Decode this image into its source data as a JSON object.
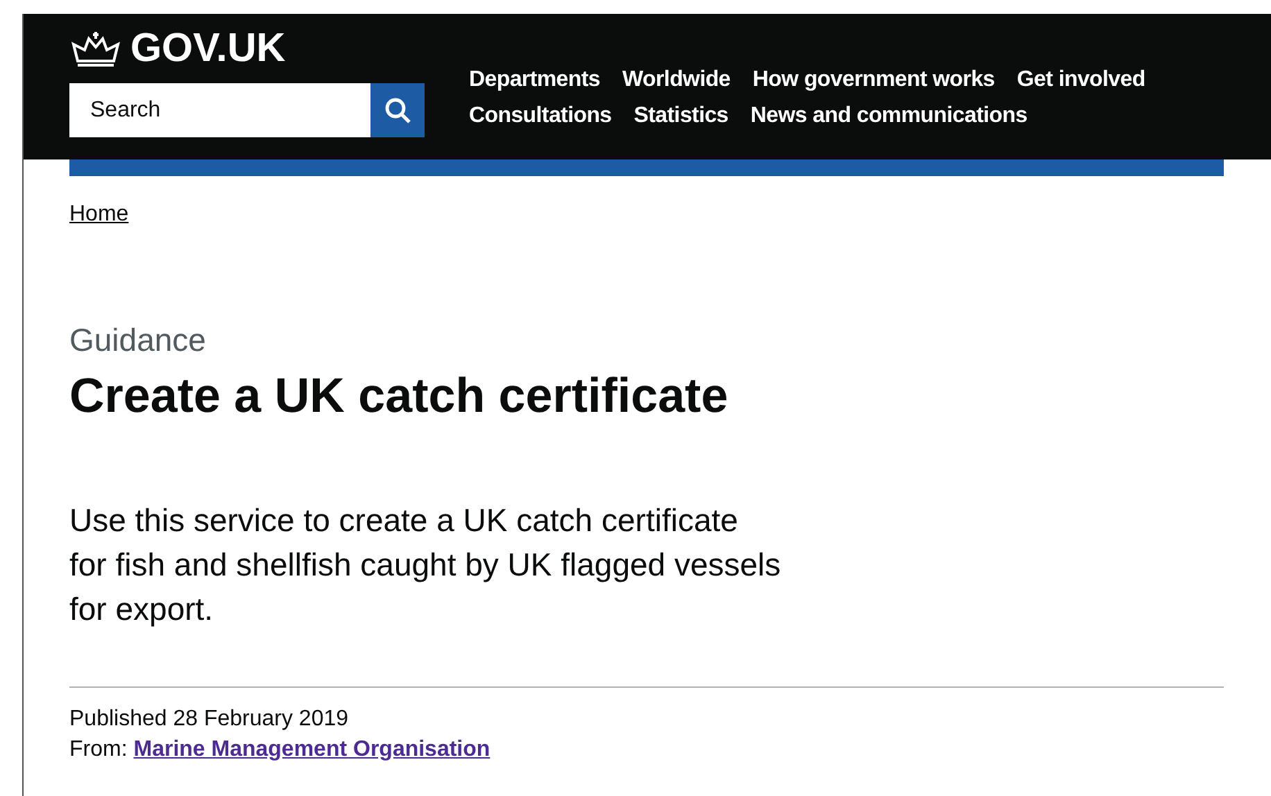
{
  "header": {
    "logo": "GOV.UK",
    "search": {
      "placeholder": "Search"
    },
    "nav": [
      [
        "Departments",
        "Worldwide",
        "How government works",
        "Get involved"
      ],
      [
        "Consultations",
        "Statistics",
        "News and communications"
      ]
    ]
  },
  "breadcrumbs": [
    "Home"
  ],
  "caption": "Guidance",
  "title": "Create a UK catch certificate",
  "summary": "Use this service to create a UK catch certificate for fish and shellfish caught by UK flagged vessels for export.",
  "metadata": {
    "published": "Published 28 February 2019",
    "from_label": "From:",
    "from_link": "Marine Management Organisation"
  }
}
